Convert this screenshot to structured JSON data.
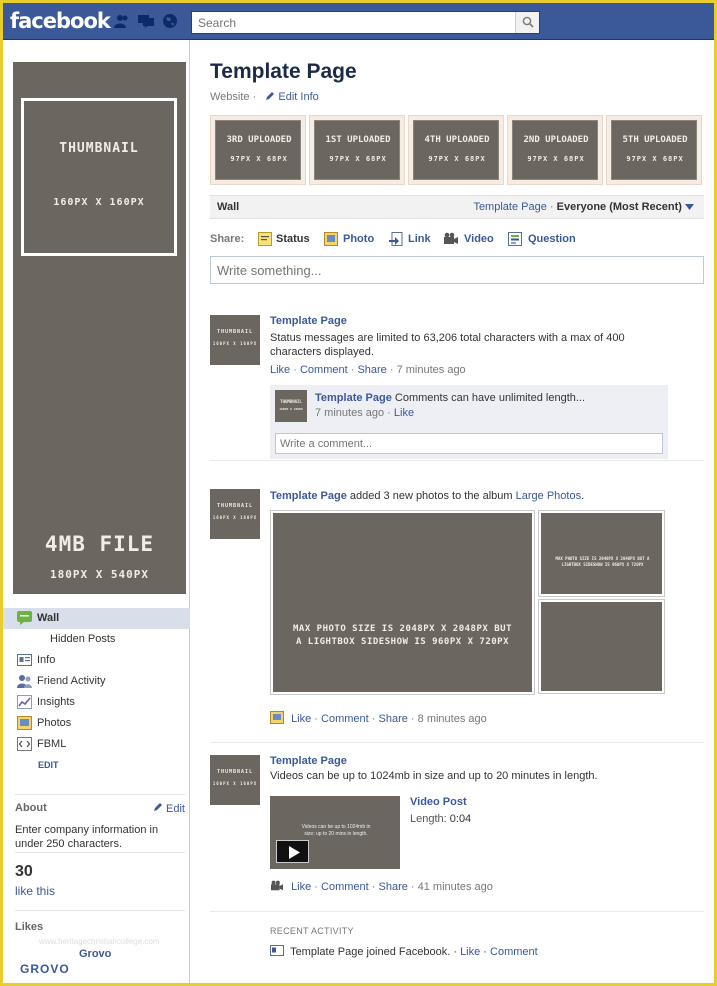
{
  "topbar": {
    "logo": "facebook",
    "search_placeholder": "Search"
  },
  "left": {
    "thumb_label": "THUMBNAIL",
    "thumb_size": "160PX X 160PX",
    "file_label": "4MB FILE",
    "file_size": "180PX X 540PX",
    "nav": [
      {
        "label": "Wall",
        "icon": "wall-icon"
      },
      {
        "label": "Hidden Posts",
        "icon": ""
      },
      {
        "label": "Info",
        "icon": "info-icon"
      },
      {
        "label": "Friend Activity",
        "icon": "friends-icon"
      },
      {
        "label": "Insights",
        "icon": "insights-icon"
      },
      {
        "label": "Photos",
        "icon": "photos-icon"
      },
      {
        "label": "FBML",
        "icon": "fbml-icon"
      }
    ],
    "edit_link": "EDIT",
    "about_head": "About",
    "about_edit": "Edit",
    "about_text": "Enter company information in under 250 characters.",
    "likes_count": "30",
    "like_this": "like this",
    "likes_head": "Likes",
    "likes_item": "Grovo",
    "likes_logo": "GROVO",
    "watermark": "www.heritagechristiancollege.com"
  },
  "main": {
    "title": "Template Page",
    "website": "Website ·",
    "edit_info": "Edit Info",
    "thumbs": [
      {
        "name": "3RD UPLOADED",
        "size": "97PX X 68PX"
      },
      {
        "name": "1ST UPLOADED",
        "size": "97PX X 68PX"
      },
      {
        "name": "4TH UPLOADED",
        "size": "97PX X 68PX"
      },
      {
        "name": "2ND UPLOADED",
        "size": "97PX X 68PX"
      },
      {
        "name": "5TH UPLOADED",
        "size": "97PX X 68PX"
      }
    ],
    "wall_label": "Wall",
    "filter_page": "Template Page",
    "filter_sep": "·",
    "filter_everyone": "Everyone (Most Recent)",
    "share_label": "Share:",
    "share_items": [
      "Status",
      "Photo",
      "Link",
      "Video",
      "Question"
    ],
    "composer_placeholder": "Write something...",
    "avatar_t1": "THUMBNAIL",
    "avatar_t2": "160PX X 160PX",
    "story1": {
      "actor": "Template Page",
      "message": "Status messages are limited to 63,206 total characters with a max of 400 characters displayed.",
      "like": "Like",
      "comment": "Comment",
      "share": "Share",
      "time": "7 minutes ago",
      "c_actor": "Template Page",
      "c_text": "Comments can have unlimited length...",
      "c_time": "7 minutes ago ·",
      "c_like": "Like",
      "write_comment": "Write a comment..."
    },
    "story2": {
      "actor": "Template Page",
      "added": "added 3 new photos to the album",
      "album": "Large Photos",
      "period": ".",
      "big_photo": "MAX PHOTO SIZE IS 2048PX X 2048PX BUT A LIGHTBOX SIDESHOW IS 960PX X 720PX",
      "small_photo": "MAX PHOTO SIZE IS 2048PX X 2048PX BUT A LIGHTBOX SIDESHOW IS 960PX X 720PX",
      "like": "Like",
      "comment": "Comment",
      "share": "Share",
      "time": "8 minutes ago"
    },
    "story3": {
      "actor": "Template Page",
      "message": "Videos can be up to 1024mb in size and up to 20 minutes in length.",
      "video_thumb": "Videos can be up to 1024mb in size; up to 20 mins in length.",
      "video_title": "Video Post",
      "length_label": "Length:",
      "length_value": "0:04",
      "like": "Like",
      "comment": "Comment",
      "share": "Share",
      "time": "41 minutes ago"
    },
    "recent": {
      "head": "RECENT ACTIVITY",
      "text": "Template Page joined Facebook. ·",
      "like": "Like",
      "comment": "Comment"
    }
  },
  "colors": {
    "brand": "#3b5998",
    "frame": "#e9cd2e",
    "placeholder_gray": "#6b6760"
  }
}
